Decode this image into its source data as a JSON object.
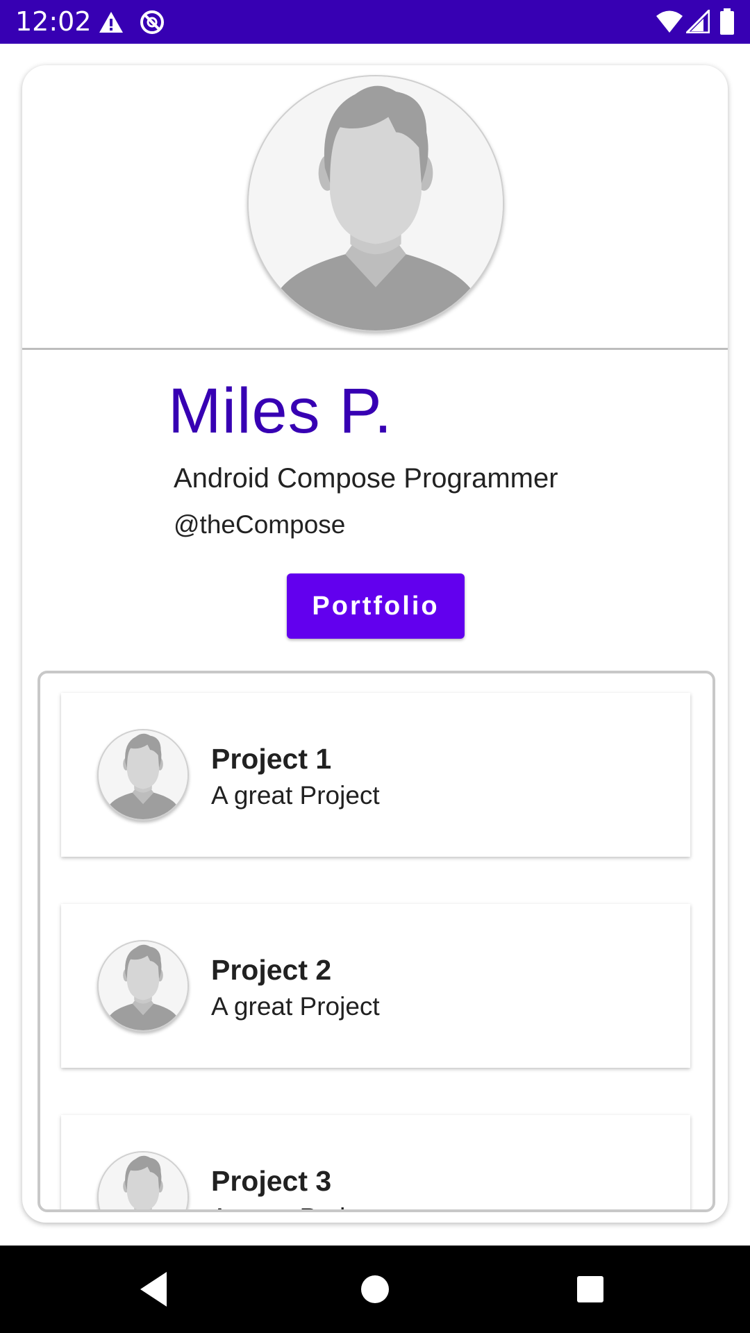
{
  "status_bar": {
    "time": "12:02",
    "icons": [
      "alert-icon",
      "no-sync-icon",
      "wifi-icon",
      "signal-icon",
      "battery-icon"
    ],
    "background": "#3700b3"
  },
  "profile": {
    "name": "Miles P.",
    "title": "Android Compose Programmer",
    "handle": "@theCompose",
    "name_color": "#3700b3"
  },
  "portfolio_button": {
    "label": "Portfolio",
    "color": "#6200ee"
  },
  "projects": [
    {
      "title": "Project 1",
      "description": "A great Project"
    },
    {
      "title": "Project 2",
      "description": "A great Project"
    },
    {
      "title": "Project 3",
      "description": "A great Project"
    }
  ],
  "nav_bar": {
    "icons": [
      "back-icon",
      "home-icon",
      "recents-icon"
    ]
  }
}
